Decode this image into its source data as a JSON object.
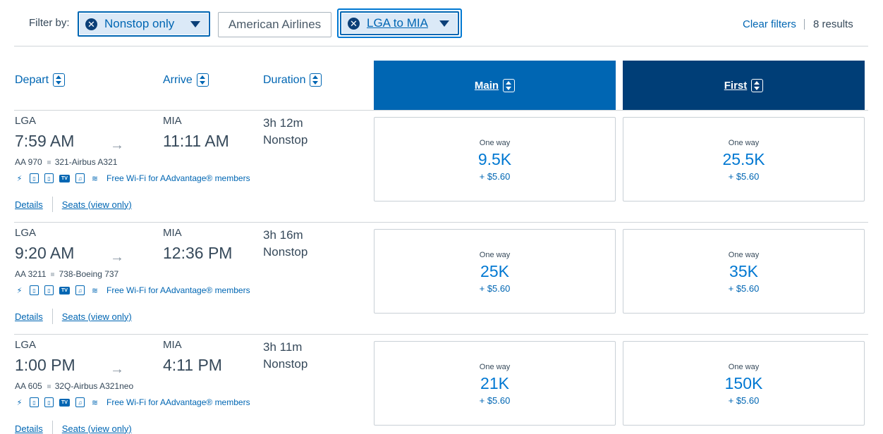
{
  "filters": {
    "label": "Filter by:",
    "chips": [
      {
        "label": "Nonstop only",
        "active": true
      },
      {
        "label": "American Airlines",
        "active": false
      },
      {
        "label": "LGA to MIA",
        "active": true
      }
    ],
    "clear_label": "Clear filters",
    "results": "8 results"
  },
  "columns": {
    "depart": "Depart",
    "arrive": "Arrive",
    "duration": "Duration",
    "main": "Main",
    "first": "First"
  },
  "colors": {
    "main_header": "#0066b3",
    "first_header": "#003e77",
    "link": "#0066b3"
  },
  "flights": [
    {
      "origin": "LGA",
      "depart_time": "7:59 AM",
      "destination": "MIA",
      "arrive_time": "11:11 AM",
      "duration": "3h 12m",
      "stops": "Nonstop",
      "flight_number": "AA 970",
      "aircraft": "321-Airbus A321",
      "wifi": "Free Wi-Fi for AAdvantage® members",
      "details": "Details",
      "seats": "Seats (view only)",
      "main": {
        "label": "One way",
        "miles": "9.5K",
        "fee": "+ $5.60"
      },
      "first": {
        "label": "One way",
        "miles": "25.5K",
        "fee": "+ $5.60"
      }
    },
    {
      "origin": "LGA",
      "depart_time": "9:20 AM",
      "destination": "MIA",
      "arrive_time": "12:36 PM",
      "duration": "3h 16m",
      "stops": "Nonstop",
      "flight_number": "AA 3211",
      "aircraft": "738-Boeing 737",
      "wifi": "Free Wi-Fi for AAdvantage® members",
      "details": "Details",
      "seats": "Seats (view only)",
      "main": {
        "label": "One way",
        "miles": "25K",
        "fee": "+ $5.60"
      },
      "first": {
        "label": "One way",
        "miles": "35K",
        "fee": "+ $5.60"
      }
    },
    {
      "origin": "LGA",
      "depart_time": "1:00 PM",
      "destination": "MIA",
      "arrive_time": "4:11 PM",
      "duration": "3h 11m",
      "stops": "Nonstop",
      "flight_number": "AA 605",
      "aircraft": "32Q-Airbus A321neo",
      "wifi": "Free Wi-Fi for AAdvantage® members",
      "details": "Details",
      "seats": "Seats (view only)",
      "main": {
        "label": "One way",
        "miles": "21K",
        "fee": "+ $5.60"
      },
      "first": {
        "label": "One way",
        "miles": "150K",
        "fee": "+ $5.60"
      }
    }
  ]
}
